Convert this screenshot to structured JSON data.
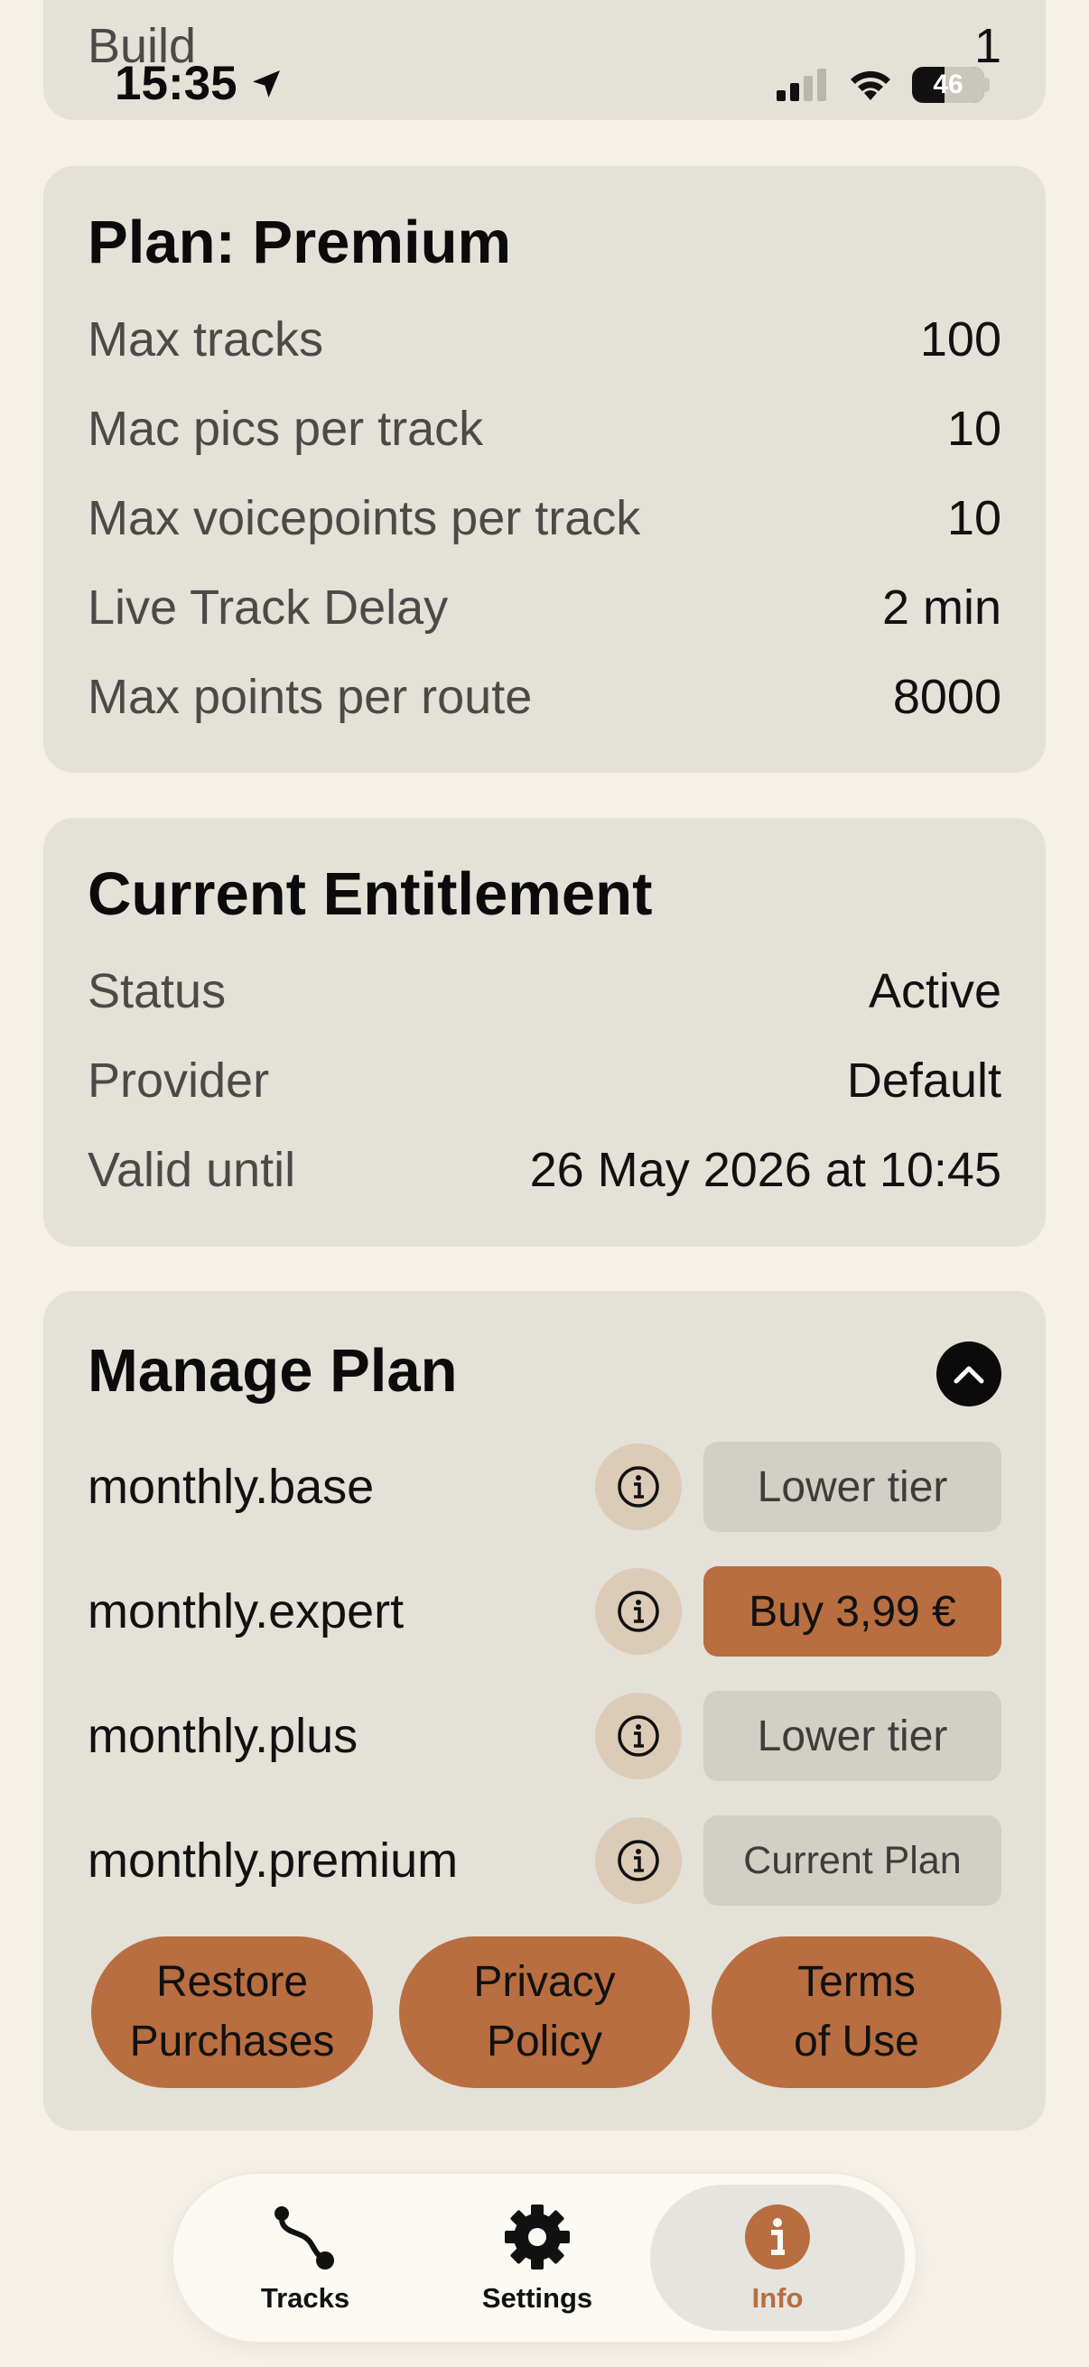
{
  "status_bar": {
    "time": "15:35",
    "battery": "46"
  },
  "build": {
    "label": "Build",
    "value": "1"
  },
  "plan": {
    "title": "Plan: Premium",
    "rows": [
      {
        "label": "Max tracks",
        "value": "100"
      },
      {
        "label": "Mac pics per track",
        "value": "10"
      },
      {
        "label": "Max voicepoints per track",
        "value": "10"
      },
      {
        "label": "Live Track Delay",
        "value": "2 min"
      },
      {
        "label": "Max points per route",
        "value": "8000"
      }
    ]
  },
  "entitlement": {
    "title": "Current Entitlement",
    "rows": [
      {
        "label": "Status",
        "value": "Active"
      },
      {
        "label": "Provider",
        "value": "Default"
      },
      {
        "label": "Valid until",
        "value": "26 May 2026 at 10:45"
      }
    ]
  },
  "manage": {
    "title": "Manage Plan",
    "products": [
      {
        "name": "monthly.base",
        "action": "Lower tier"
      },
      {
        "name": "monthly.expert",
        "action": "Buy 3,99 €"
      },
      {
        "name": "monthly.plus",
        "action": "Lower tier"
      },
      {
        "name": "monthly.premium",
        "action": "Current Plan"
      }
    ],
    "restore_line1": "Restore",
    "restore_line2": "Purchases",
    "privacy_line1": "Privacy",
    "privacy_line2": "Policy",
    "terms_line1": "Terms",
    "terms_line2": "of Use"
  },
  "tabbar": {
    "tabs": [
      {
        "label": "Tracks",
        "icon": "route-icon"
      },
      {
        "label": "Settings",
        "icon": "gear-icon"
      },
      {
        "label": "Info",
        "icon": "info-icon"
      }
    ],
    "active": "Info"
  },
  "colors": {
    "accent": "#b86e40",
    "card": "#e4e1d8",
    "background": "#f5f1e8"
  }
}
